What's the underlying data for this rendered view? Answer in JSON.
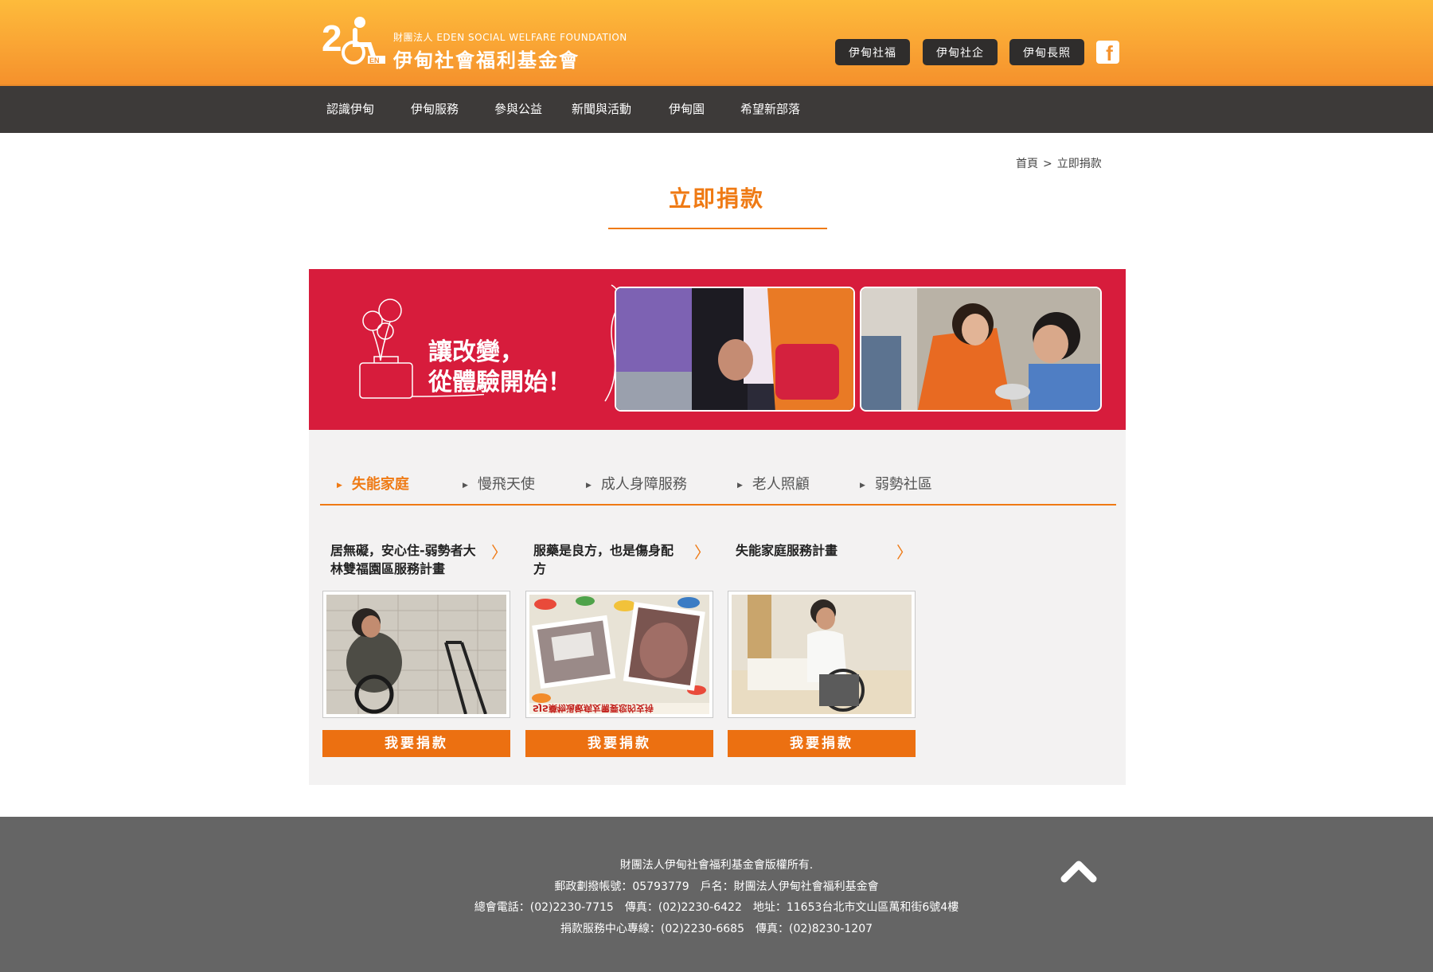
{
  "header": {
    "logo_sub": "財團法人 EDEN SOCIAL WELFARE FOUNDATION",
    "logo_main": "伊甸社會福利基金會",
    "logo_icon": "eden-25-wheelchair-logo",
    "top_links": [
      "伊甸社福",
      "伊甸社企",
      "伊甸長照"
    ],
    "facebook_icon": "facebook-icon",
    "accent": "#f5912c"
  },
  "nav": {
    "items": [
      "認識伊甸",
      "伊甸服務",
      "參與公益",
      "新聞與活動",
      "伊甸園",
      "希望新部落"
    ]
  },
  "breadcrumb": {
    "home": "首頁",
    "separator": ">",
    "current": "立即捐款"
  },
  "page_title": "立即捐款",
  "banner": {
    "line1": "讓改變，",
    "line2": "從體驗開始！",
    "bg_color": "#d71c3c"
  },
  "tabs": {
    "items": [
      "失能家庭",
      "慢飛天使",
      "成人身障服務",
      "老人照顧",
      "弱勢社區"
    ],
    "active_index": 0
  },
  "cards": [
    {
      "title": "居無礙，安心住-弱勢者大林雙福園區服務計畫",
      "button": "我要捐款"
    },
    {
      "title": "服藥是良方，也是傷身配方",
      "image_caption": "SJS藥物過敏病友需要您的支持",
      "button": "我要捐款"
    },
    {
      "title": "失能家庭服務計畫",
      "button": "我要捐款"
    }
  ],
  "footer": {
    "line1": "財團法人伊甸社會福利基金會版權所有.",
    "line2": "郵政劃撥帳號：05793779　戶名：財團法人伊甸社會福利基金會",
    "line3": "總會電話：(02)2230-7715　傳真：(02)2230-6422　地址：11653台北市文山區萬和街6號4樓",
    "line4": "捐款服務中心專線：(02)2230-6685　傳真：(02)8230-1207",
    "back_to_top_icon": "chevron-up-icon"
  }
}
